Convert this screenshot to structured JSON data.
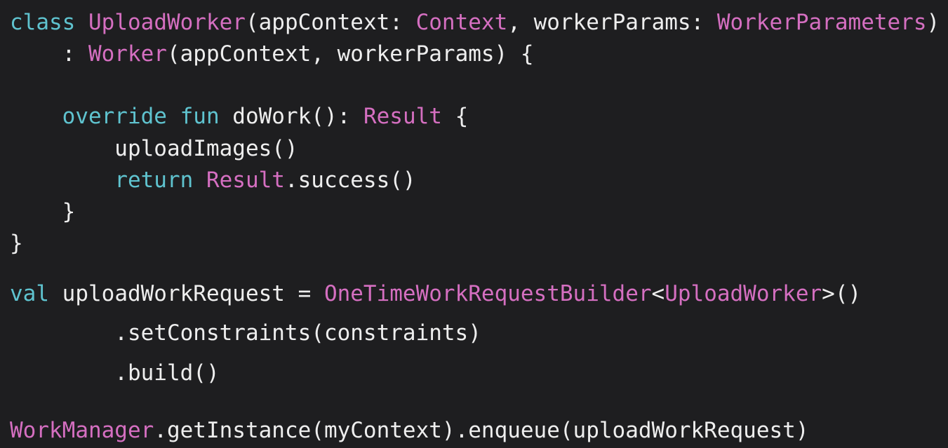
{
  "code": {
    "lines": [
      [
        {
          "t": "class",
          "c": "kw"
        },
        {
          "t": " ",
          "c": "pl"
        },
        {
          "t": "UploadWorker",
          "c": "ty"
        },
        {
          "t": "(appContext: ",
          "c": "pl"
        },
        {
          "t": "Context",
          "c": "ty"
        },
        {
          "t": ", workerParams: ",
          "c": "pl"
        },
        {
          "t": "WorkerParameters",
          "c": "ty"
        },
        {
          "t": ")",
          "c": "pl"
        }
      ],
      [
        {
          "t": "    : ",
          "c": "pl"
        },
        {
          "t": "Worker",
          "c": "ty"
        },
        {
          "t": "(appContext, workerParams) {",
          "c": "pl"
        }
      ],
      [],
      [
        {
          "t": "    ",
          "c": "pl"
        },
        {
          "t": "override",
          "c": "kw"
        },
        {
          "t": " ",
          "c": "pl"
        },
        {
          "t": "fun",
          "c": "kw"
        },
        {
          "t": " doWork(): ",
          "c": "pl"
        },
        {
          "t": "Result",
          "c": "ty"
        },
        {
          "t": " {",
          "c": "pl"
        }
      ],
      [
        {
          "t": "        uploadImages()",
          "c": "pl"
        }
      ],
      [
        {
          "t": "        ",
          "c": "pl"
        },
        {
          "t": "return",
          "c": "kw"
        },
        {
          "t": " ",
          "c": "pl"
        },
        {
          "t": "Result",
          "c": "ty"
        },
        {
          "t": ".success()",
          "c": "pl"
        }
      ],
      [
        {
          "t": "    }",
          "c": "pl"
        }
      ],
      [
        {
          "t": "}",
          "c": "pl"
        }
      ],
      [],
      [
        {
          "t": "val",
          "c": "kw"
        },
        {
          "t": " uploadWorkRequest = ",
          "c": "pl"
        },
        {
          "t": "OneTimeWorkRequestBuilder",
          "c": "ty"
        },
        {
          "t": "<",
          "c": "pl"
        },
        {
          "t": "UploadWorker",
          "c": "ty"
        },
        {
          "t": ">()",
          "c": "pl"
        }
      ],
      [
        {
          "t": "        .setConstraints(constraints)",
          "c": "pl"
        }
      ],
      [
        {
          "t": "        .build()",
          "c": "pl"
        }
      ],
      [],
      [
        {
          "t": "WorkManager",
          "c": "ty"
        },
        {
          "t": ".getInstance(myContext).enqueue(uploadWorkRequest)",
          "c": "pl"
        }
      ]
    ]
  }
}
